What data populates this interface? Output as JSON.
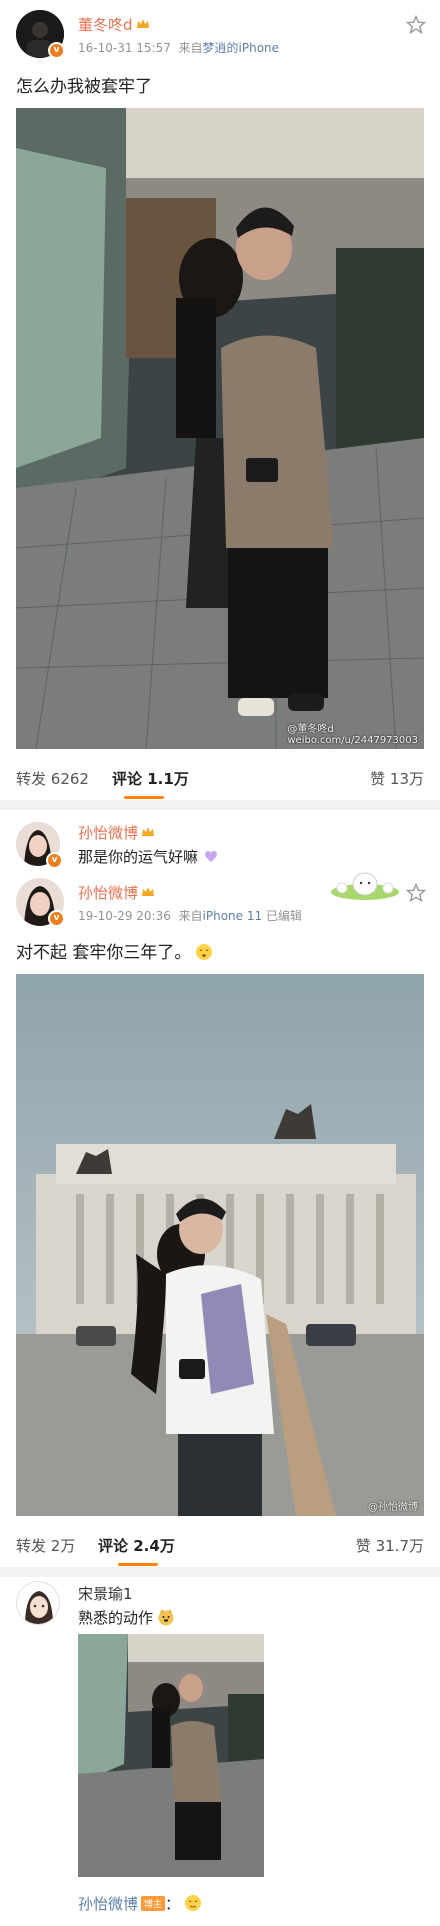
{
  "post1": {
    "username": "董冬咚d",
    "timestamp": "16-10-31 15:57",
    "source_prefix": "来自",
    "source": "梦逍的iPhone",
    "text": "怎么办我被套牢了",
    "watermark": "weibo.com/u/2447973003",
    "watermark_user": "@董冬咚d",
    "repost_label": "转发",
    "repost_count": "6262",
    "comment_label": "评论",
    "comment_count": "1.1万",
    "like_label": "赞",
    "like_count": "13万"
  },
  "reply1": {
    "username": "孙怡微博",
    "text": "那是你的运气好嘛"
  },
  "post2": {
    "username": "孙怡微博",
    "timestamp": "19-10-29 20:36",
    "source_prefix": "来自",
    "source": "iPhone 11",
    "edited": "已编辑",
    "text": "对不起  套牢你三年了。",
    "watermark": "@孙怡微博",
    "repost_label": "转发",
    "repost_count": "2万",
    "comment_label": "评论",
    "comment_count": "2.4万",
    "like_label": "赞",
    "like_count": "31.7万"
  },
  "comment1": {
    "username": "宋景瑜1",
    "text": "熟悉的动作",
    "nested_user": "孙怡微博",
    "nested_badge": "博主",
    "nested_sep": "："
  },
  "colors": {
    "name": "#eb7350",
    "accent": "#ff8200",
    "link": "#5d7fa8"
  },
  "icons": [
    "verified-badge-icon",
    "crown-icon",
    "star-icon",
    "heart-emoji-icon",
    "blush-emoji-icon",
    "doge-emoji-icon"
  ]
}
